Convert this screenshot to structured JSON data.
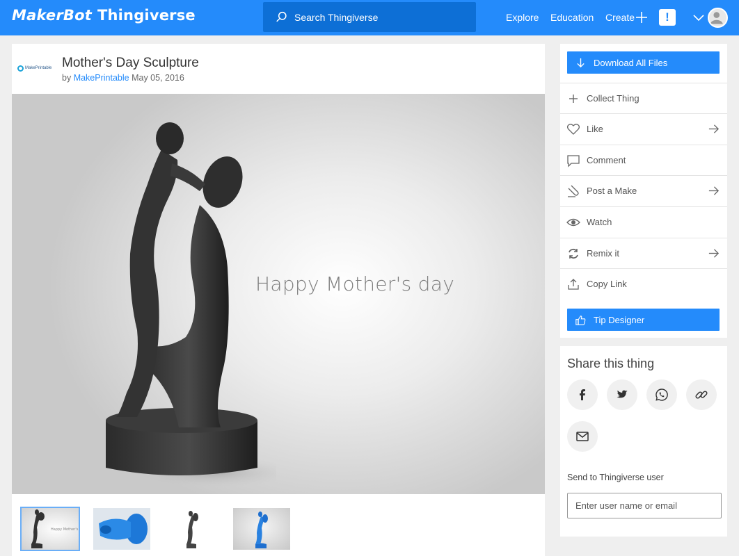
{
  "header": {
    "brand_maker": "MakerBot",
    "brand_thing": "Thingiverse",
    "search_placeholder": "Search Thingiverse",
    "nav": {
      "explore": "Explore",
      "education": "Education",
      "create": "Create"
    },
    "notice_glyph": "!"
  },
  "thing": {
    "designer_logo_text": "MakePrintable",
    "title": "Mother's Day Sculpture",
    "by": "by",
    "author": "MakePrintable",
    "date": "May 05, 2016",
    "image_caption": "Happy Mother's day"
  },
  "actions": {
    "download_all": "Download All Files",
    "collect": "Collect Thing",
    "like": "Like",
    "comment": "Comment",
    "post_make": "Post a Make",
    "watch": "Watch",
    "remix": "Remix it",
    "copy_link": "Copy Link",
    "tip": "Tip Designer"
  },
  "share": {
    "title": "Share this thing",
    "send_label": "Send to Thingiverse user",
    "send_placeholder": "Enter user name or email"
  },
  "colors": {
    "accent": "#248bfb",
    "search_bg": "#0d6fd6",
    "page_bg": "#efefef"
  },
  "icons": [
    "search-icon",
    "plus-icon",
    "notice-icon",
    "chevron-down-icon",
    "avatar-icon",
    "download-icon",
    "heart-icon",
    "comment-icon",
    "post-make-icon",
    "eye-icon",
    "remix-icon",
    "share-icon",
    "thumbs-up-icon",
    "arrow-right-icon",
    "facebook-icon",
    "twitter-icon",
    "whatsapp-icon",
    "link-icon",
    "email-icon"
  ]
}
